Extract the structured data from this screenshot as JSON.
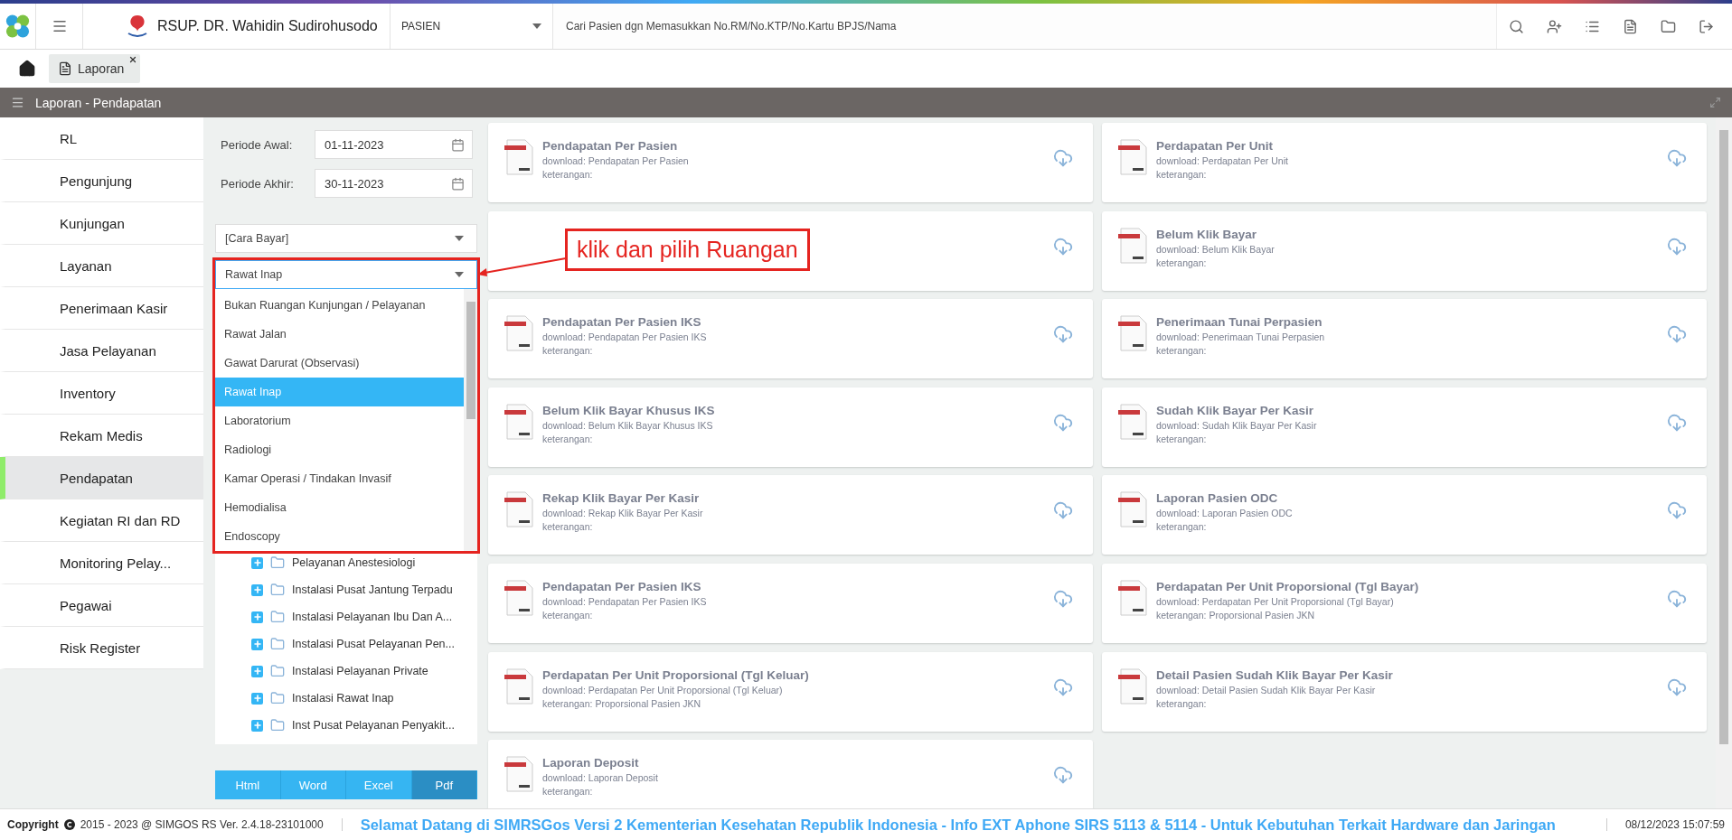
{
  "header": {
    "hospital_name": "RSUP. DR. Wahidin Sudirohusodo",
    "search_category": "PASIEN",
    "search_placeholder": "Cari Pasien dgn Memasukkan No.RM/No.KTP/No.Kartu BPJS/Nama"
  },
  "tabs": [
    {
      "label": "Laporan",
      "selected": true
    }
  ],
  "page_title": "Laporan - Pendapatan",
  "sidebar": {
    "items": [
      {
        "label": "RL",
        "selected": false
      },
      {
        "label": "Pengunjung",
        "selected": false
      },
      {
        "label": "Kunjungan",
        "selected": false
      },
      {
        "label": "Layanan",
        "selected": false
      },
      {
        "label": "Penerimaan Kasir",
        "selected": false
      },
      {
        "label": "Jasa Pelayanan",
        "selected": false
      },
      {
        "label": "Inventory",
        "selected": false
      },
      {
        "label": "Rekam Medis",
        "selected": false
      },
      {
        "label": "Pendapatan",
        "selected": true
      },
      {
        "label": "Kegiatan RI dan RD",
        "selected": false
      },
      {
        "label": "Monitoring Pelay...",
        "selected": false
      },
      {
        "label": "Pegawai",
        "selected": false
      },
      {
        "label": "Risk Register",
        "selected": false
      }
    ]
  },
  "filters": {
    "periode_awal": {
      "label": "Periode Awal:",
      "value": "01-11-2023"
    },
    "periode_akhir": {
      "label": "Periode Akhir:",
      "value": "30-11-2023"
    },
    "cara_bayar": {
      "placeholder": "[Cara Bayar]"
    },
    "ruangan": {
      "value": "Rawat Inap",
      "expanded": true,
      "options": [
        {
          "label": "Bukan Ruangan Kunjungan / Pelayanan",
          "selected": false
        },
        {
          "label": "Rawat Jalan",
          "selected": false
        },
        {
          "label": "Gawat Darurat (Observasi)",
          "selected": false
        },
        {
          "label": "Rawat Inap",
          "selected": true
        },
        {
          "label": "Laboratorium",
          "selected": false
        },
        {
          "label": "Radiologi",
          "selected": false
        },
        {
          "label": "Kamar Operasi / Tindakan Invasif",
          "selected": false
        },
        {
          "label": "Hemodialisa",
          "selected": false
        },
        {
          "label": "Endoscopy",
          "selected": false
        }
      ]
    }
  },
  "tree": {
    "items": [
      {
        "label": "Pelayanan Anestesiologi"
      },
      {
        "label": "Instalasi Pusat Jantung Terpadu"
      },
      {
        "label": "Instalasi Pelayanan Ibu Dan A..."
      },
      {
        "label": "Instalasi Pusat Pelayanan Pen..."
      },
      {
        "label": "Instalasi Pelayanan Private"
      },
      {
        "label": "Instalasi Rawat Inap"
      },
      {
        "label": "Inst Pusat Pelayanan Penyakit..."
      }
    ]
  },
  "export_buttons": [
    {
      "label": "Html",
      "selected": false
    },
    {
      "label": "Word",
      "selected": false
    },
    {
      "label": "Excel",
      "selected": false
    },
    {
      "label": "Pdf",
      "selected": true
    }
  ],
  "reports": [
    {
      "kind": "report",
      "title": "Pendapatan Per Pasien",
      "download": "download: Pendapatan Per Pasien",
      "note": "keterangan:"
    },
    {
      "kind": "report",
      "title": "Perdapatan Per Unit",
      "download": "download: Perdapatan Per Unit",
      "note": "keterangan:"
    },
    {
      "kind": "blank"
    },
    {
      "kind": "report",
      "title": "Belum Klik Bayar",
      "download": "download: Belum Klik Bayar",
      "note": "keterangan:"
    },
    {
      "kind": "report",
      "title": "Pendapatan Per Pasien IKS",
      "download": "download: Pendapatan Per Pasien IKS",
      "note": "keterangan:"
    },
    {
      "kind": "report",
      "title": "Penerimaan Tunai Perpasien",
      "download": "download: Penerimaan Tunai Perpasien",
      "note": "keterangan:"
    },
    {
      "kind": "report",
      "title": "Belum Klik Bayar Khusus IKS",
      "download": "download: Belum Klik Bayar Khusus IKS",
      "note": "keterangan:"
    },
    {
      "kind": "report",
      "title": "Sudah Klik Bayar Per Kasir",
      "download": "download: Sudah Klik Bayar Per Kasir",
      "note": "keterangan:"
    },
    {
      "kind": "report",
      "title": "Rekap Klik Bayar Per Kasir",
      "download": "download: Rekap Klik Bayar Per Kasir",
      "note": "keterangan:"
    },
    {
      "kind": "report",
      "title": "Laporan Pasien ODC",
      "download": "download: Laporan Pasien ODC",
      "note": "keterangan:"
    },
    {
      "kind": "report",
      "title": "Pendapatan Per Pasien IKS",
      "download": "download: Pendapatan Per Pasien IKS",
      "note": "keterangan:"
    },
    {
      "kind": "report",
      "title": "Perdapatan Per Unit Proporsional (Tgl Bayar)",
      "download": "download: Perdapatan Per Unit Proporsional (Tgl Bayar)",
      "note": "keterangan: Proporsional Pasien JKN"
    },
    {
      "kind": "report",
      "title": "Perdapatan Per Unit Proporsional (Tgl Keluar)",
      "download": "download: Perdapatan Per Unit Proporsional (Tgl Keluar)",
      "note": "keterangan: Proporsional Pasien JKN"
    },
    {
      "kind": "report",
      "title": "Detail Pasien Sudah Klik Bayar Per Kasir",
      "download": "download: Detail Pasien Sudah Klik Bayar Per Kasir",
      "note": "keterangan:"
    },
    {
      "kind": "report",
      "title": "Laporan Deposit",
      "download": "download: Laporan Deposit",
      "note": "keterangan:"
    }
  ],
  "annotation": {
    "text": "klik dan pilih Ruangan"
  },
  "footer": {
    "copyright_label": "Copyright",
    "copyright_text": "2015 - 2023 @ SIMGOS RS Ver. 2.4.18-23101000",
    "marquee": "Selamat Datang di SIMRSGos Versi 2 Kementerian Kesehatan Republik Indonesia - Info EXT Aphone SIRS 5113 & 5114 - Untuk Kebutuhan Terkait Hardware dan Jaringan",
    "datetime": "08/12/2023 15:07:59"
  }
}
